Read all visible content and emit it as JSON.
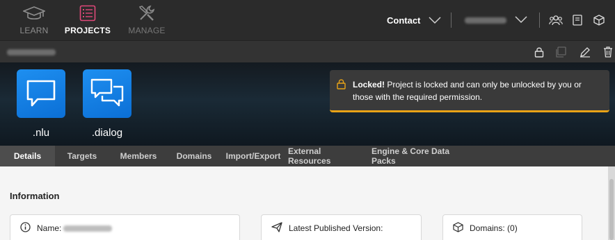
{
  "nav": {
    "learn": "LEARN",
    "projects": "PROJECTS",
    "manage": "MANAGE",
    "contact": "Contact"
  },
  "icons": {
    "learn": "graduation-cap-icon",
    "projects": "list-icon",
    "manage": "tools-icon",
    "team": "team-icon",
    "docs": "book-icon",
    "cube": "cube-icon"
  },
  "colors": {
    "accent_pink": "#e0487a",
    "tile_blue": "#1e8ff0",
    "lock_warning": "#e8a317"
  },
  "apps": [
    {
      "label": ".nlu"
    },
    {
      "label": ".dialog"
    }
  ],
  "locked": {
    "title": "Locked!",
    "message": "Project is locked and can only be unlocked by you or those with the required permission."
  },
  "tabs": [
    "Details",
    "Targets",
    "Members",
    "Domains",
    "Import/Export",
    "External Resources",
    "Engine & Core Data Packs"
  ],
  "information": {
    "heading": "Information",
    "name_label": "Name:",
    "published_label": "Latest Published Version:",
    "domains_label": "Domains: (0)"
  }
}
